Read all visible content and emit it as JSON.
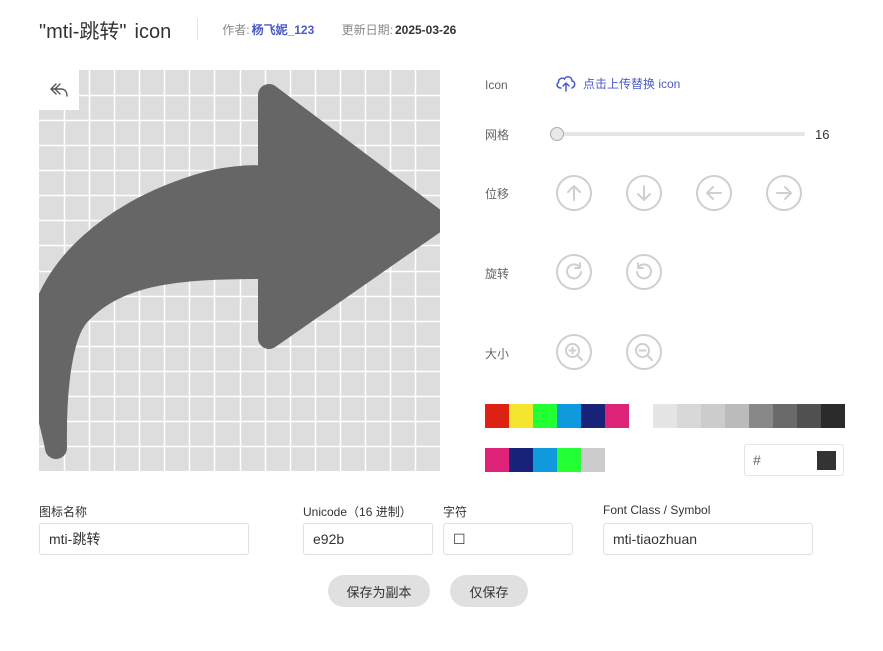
{
  "header": {
    "title": "\"mti-跳转\"",
    "title_suffix": "icon",
    "author_label": "作者:",
    "author": "杨飞妮_123",
    "date_label": "更新日期:",
    "date": "2025-03-26"
  },
  "canvas": {
    "undo_icon": "undo-icon",
    "grid_color": "#ffffff",
    "background_color": "#dddddd",
    "icon_color": "#666666"
  },
  "controls": {
    "icon_label": "Icon",
    "upload_label": "点击上传替换 icon",
    "upload_icon": "cloud-upload-icon",
    "grid_label": "网格",
    "grid_value": "16",
    "offset_label": "位移",
    "rotate_label": "旋转",
    "size_label": "大小"
  },
  "colors": {
    "row1_bright": [
      "#dd2211",
      "#f5e52e",
      "#22ff33",
      "#1199dd",
      "#172278",
      "#dd2277"
    ],
    "row1_gray": [
      "#e5e5e5",
      "#d8d8d8",
      "#cccccc",
      "#bbbbbb",
      "#888888",
      "#6a6a6a",
      "#505050",
      "#2b2b2b"
    ],
    "recent": [
      "#dd2277",
      "#172278",
      "#1199dd",
      "#22ff33",
      "#cccccc"
    ],
    "hash": "#",
    "current": "#333333"
  },
  "fields": {
    "name_label": "图标名称",
    "name_value": "mti-跳转",
    "unicode_label": "Unicode（16 进制）",
    "unicode_value": "e92b",
    "char_label": "字符",
    "char_value": "☐",
    "class_label": "Font Class / Symbol",
    "class_value": "mti-tiaozhuan"
  },
  "buttons": {
    "save_copy": "保存为副本",
    "save_only": "仅保存"
  }
}
